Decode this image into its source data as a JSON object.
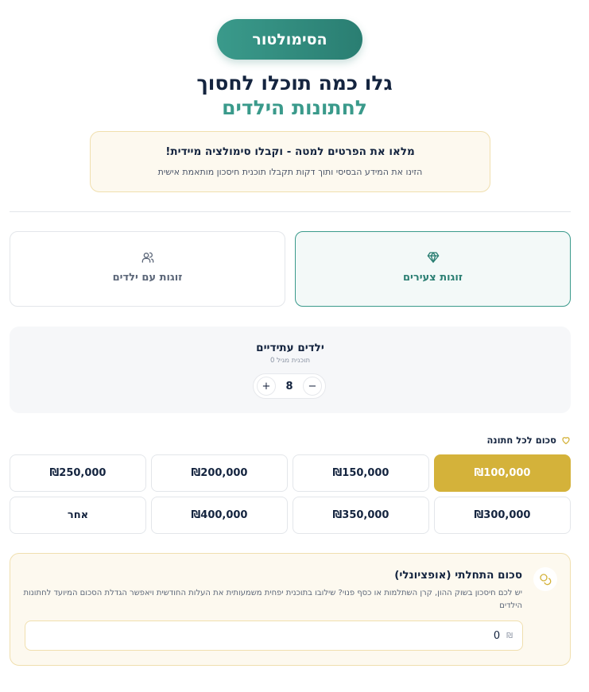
{
  "header": {
    "badge": "הסימולטור",
    "title_line1": "גלו כמה תוכלו לחסוך",
    "title_line2": "לחתונות הילדים"
  },
  "notice": {
    "title": "מלאו את הפרטים למטה - וקבלו סימולציה מיידית!",
    "subtitle": "הזינו את המידע הבסיסי ותוך דקות תקבלו תוכנית חיסכון מותאמת אישית"
  },
  "couple_types": [
    {
      "label": "זוגות צעירים",
      "icon": "diamond-icon",
      "selected": true
    },
    {
      "label": "זוגות עם ילדים",
      "icon": "users-icon",
      "selected": false
    }
  ],
  "kids": {
    "title": "ילדים עתידיים",
    "subtitle": "תוכנית מגיל 0",
    "value": "8",
    "plus": "+",
    "minus": "−"
  },
  "amount": {
    "label": "סכום לכל חתונה",
    "icon": "heart-icon",
    "options": [
      "₪100,000",
      "₪150,000",
      "₪200,000",
      "₪250,000",
      "₪300,000",
      "₪350,000",
      "₪400,000",
      "אחר"
    ],
    "selected": "₪100,000"
  },
  "initial": {
    "title": "סכום התחלתי (אופציונלי)",
    "description": "יש לכם חיסכון בשוק ההון, קרן השתלמות או כסף פנוי? שילובו בתוכנית יפחית משמעותית את העלות החודשית ויאפשר הגדלת הסכום המיועד לחתונות הילדים",
    "currency": "₪",
    "value": "0",
    "icon": "coins-icon"
  },
  "colors": {
    "primary": "#3a9a8b",
    "gold": "#d4b23a",
    "navy": "#14243f"
  }
}
